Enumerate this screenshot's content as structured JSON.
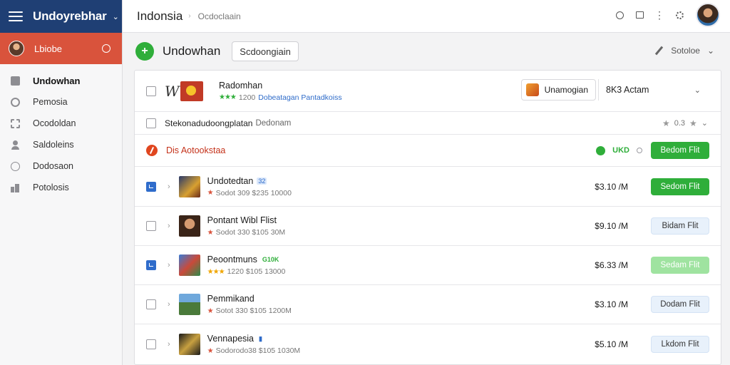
{
  "sidebar": {
    "title": "Undoyrebhar",
    "user_name": "Lbiobe",
    "items": [
      {
        "label": "Undowhan",
        "icon": "page-icon",
        "active": true
      },
      {
        "label": "Pemosia",
        "icon": "gear-icon",
        "active": false
      },
      {
        "label": "Ocodoldan",
        "icon": "tree-icon",
        "active": false
      },
      {
        "label": "Saldoleins",
        "icon": "user-icon",
        "active": false
      },
      {
        "label": "Dodosaon",
        "icon": "clock-icon",
        "active": false
      },
      {
        "label": "Potolosis",
        "icon": "bars-icon",
        "active": false
      }
    ]
  },
  "topbar": {
    "title": "Indonsia",
    "breadcrumb": "Ocdoclaain"
  },
  "page": {
    "title": "Undowhan",
    "field_value": "Scdoongiain",
    "right_action": "Sotoloe"
  },
  "header_row": {
    "name": "Radomhan",
    "stars": "★★★",
    "sub_text": "1200",
    "link": "Dobeatagan Pantadkoiss",
    "button_label": "Unamogian",
    "select_value": "8K3 Actam"
  },
  "filter_row": {
    "label": "Stekonadudoongplatan",
    "secondary": "Dedonam",
    "rating": "0.3"
  },
  "alert_row": {
    "text": "Dis Aotookstaa",
    "status": "UKD",
    "action_label": "Bedom Flit"
  },
  "items": [
    {
      "name": "Undotedtan",
      "tag": "32",
      "tag_style": "blue",
      "stars": "★",
      "sub": "Sodot 309 $235 10000",
      "price": "$3.10 /M",
      "action": "Sedom Flit",
      "action_style": "solid",
      "checked": true,
      "thumb": "linear-gradient(135deg,#2a3a6a,#d8a030 60%,#6a2a1a)"
    },
    {
      "name": "Pontant Wibl Flist",
      "tag": "",
      "tag_style": "",
      "stars": "★",
      "sub": "Sodot 330 $105 30M",
      "price": "$9.10 /M",
      "action": "Bidam Flit",
      "action_style": "pale",
      "checked": false,
      "thumb": "radial-gradient(circle at 50% 40%,#d49a70 0 30%,#3a2418 32% 100%)"
    },
    {
      "name": "Peoontmuns",
      "tag": "G10K",
      "tag_style": "green",
      "stars": "★★★",
      "sub": "1220 $105 13000",
      "price": "$6.33 /M",
      "action": "Sedam Flit",
      "action_style": "light-green",
      "checked": true,
      "thumb": "linear-gradient(135deg,#3a7bd5,#c94a3a 50%,#2e8b4a)"
    },
    {
      "name": "Pemmikand",
      "tag": "",
      "tag_style": "",
      "stars": "★",
      "sub": "Sotot 330 $105 1200M",
      "price": "$3.10 /M",
      "action": "Dodam Flit",
      "action_style": "pale",
      "checked": false,
      "thumb": "linear-gradient(180deg,#6fa8dc 0 40%,#4a7a3a 40% 100%)"
    },
    {
      "name": "Vennapesia",
      "tag": "▮",
      "tag_style": "pin",
      "stars": "★",
      "sub": "Sodorodo38 $105 1030M",
      "price": "$5.10 /M",
      "action": "Lkdom Flit",
      "action_style": "pale",
      "checked": false,
      "thumb": "linear-gradient(135deg,#1a1a1a,#c8a040 50%,#1a1a1a)"
    }
  ]
}
